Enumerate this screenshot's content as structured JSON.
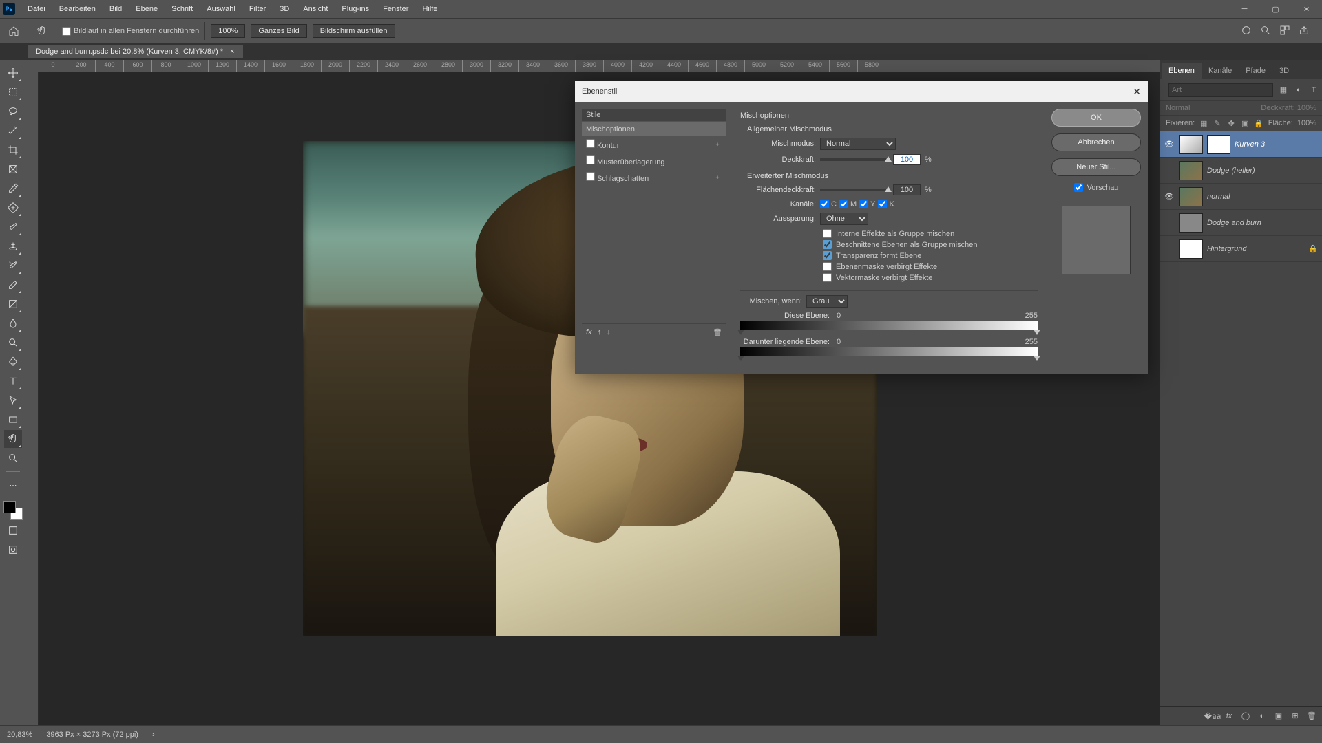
{
  "menubar": [
    "Datei",
    "Bearbeiten",
    "Bild",
    "Ebene",
    "Schrift",
    "Auswahl",
    "Filter",
    "3D",
    "Ansicht",
    "Plug-ins",
    "Fenster",
    "Hilfe"
  ],
  "optionsbar": {
    "scroll_all": "Bildlauf in allen Fenstern durchführen",
    "zoom": "100%",
    "fit": "Ganzes Bild",
    "fill": "Bildschirm ausfüllen"
  },
  "document_tab": "Dodge and burn.psdc bei 20,8% (Kurven 3, CMYK/8#) *",
  "ruler_ticks": [
    "0",
    "200",
    "400",
    "600",
    "800",
    "1000",
    "1200",
    "1400",
    "1600",
    "1800",
    "2000",
    "2200",
    "2400",
    "2600",
    "2800",
    "3000",
    "3200",
    "3400",
    "3600",
    "3800",
    "4000",
    "4200",
    "4400",
    "4600",
    "4800",
    "5000",
    "5200",
    "5400",
    "5600",
    "5800"
  ],
  "panels": {
    "tabs": [
      "Ebenen",
      "Kanäle",
      "Pfade",
      "3D"
    ],
    "search_placeholder": "Art",
    "mode_label": "Normal",
    "opacity_label": "Deckkraft:",
    "opacity_value": "100%",
    "lock_label": "Fixieren:",
    "fill_label": "Fläche:",
    "fill_value": "100%",
    "layers": [
      {
        "name": "Kurven 3",
        "visible": true,
        "thumb": "curves",
        "mask": true,
        "selected": true
      },
      {
        "name": "Dodge (heller)",
        "visible": false,
        "thumb": "photo",
        "mask": false
      },
      {
        "name": "normal",
        "visible": true,
        "thumb": "photo",
        "mask": false
      },
      {
        "name": "Dodge and burn",
        "visible": false,
        "thumb": "folder",
        "mask": false
      },
      {
        "name": "Hintergrund",
        "visible": false,
        "thumb": "mask",
        "mask": false,
        "locked": true
      }
    ]
  },
  "dialog": {
    "title": "Ebenenstil",
    "left_header": "Stile",
    "left_items": [
      {
        "label": "Mischoptionen",
        "selected": true,
        "add": false,
        "chk": null
      },
      {
        "label": "Kontur",
        "selected": false,
        "add": true,
        "chk": false
      },
      {
        "label": "Musterüberlagerung",
        "selected": false,
        "add": false,
        "chk": false
      },
      {
        "label": "Schlagschatten",
        "selected": false,
        "add": true,
        "chk": false
      }
    ],
    "section": "Mischoptionen",
    "general_section": "Allgemeiner Mischmodus",
    "blend_mode_label": "Mischmodus:",
    "blend_mode_value": "Normal",
    "opacity_label": "Deckkraft:",
    "opacity_value": "100",
    "pct": "%",
    "advanced_section": "Erweiterter Mischmodus",
    "fill_opacity_label": "Flächendeckkraft:",
    "fill_opacity_value": "100",
    "channels_label": "Kanäle:",
    "channels": [
      "C",
      "M",
      "Y",
      "K"
    ],
    "knockout_label": "Aussparung:",
    "knockout_value": "Ohne",
    "checks": [
      {
        "label": "Interne Effekte als Gruppe mischen",
        "checked": false
      },
      {
        "label": "Beschnittene Ebenen als Gruppe mischen",
        "checked": true
      },
      {
        "label": "Transparenz formt Ebene",
        "checked": true
      },
      {
        "label": "Ebenenmaske verbirgt Effekte",
        "checked": false
      },
      {
        "label": "Vektormaske verbirgt Effekte",
        "checked": false
      }
    ],
    "blendif_label": "Mischen, wenn:",
    "blendif_value": "Grau",
    "this_layer_label": "Diese Ebene:",
    "this_layer_low": "0",
    "this_layer_high": "255",
    "under_layer_label": "Darunter liegende Ebene:",
    "under_layer_low": "0",
    "under_layer_high": "255",
    "ok": "OK",
    "cancel": "Abbrechen",
    "new_style": "Neuer Stil...",
    "preview": "Vorschau"
  },
  "status": {
    "zoom": "20,83%",
    "info": "3963 Px × 3273 Px (72 ppi)"
  }
}
